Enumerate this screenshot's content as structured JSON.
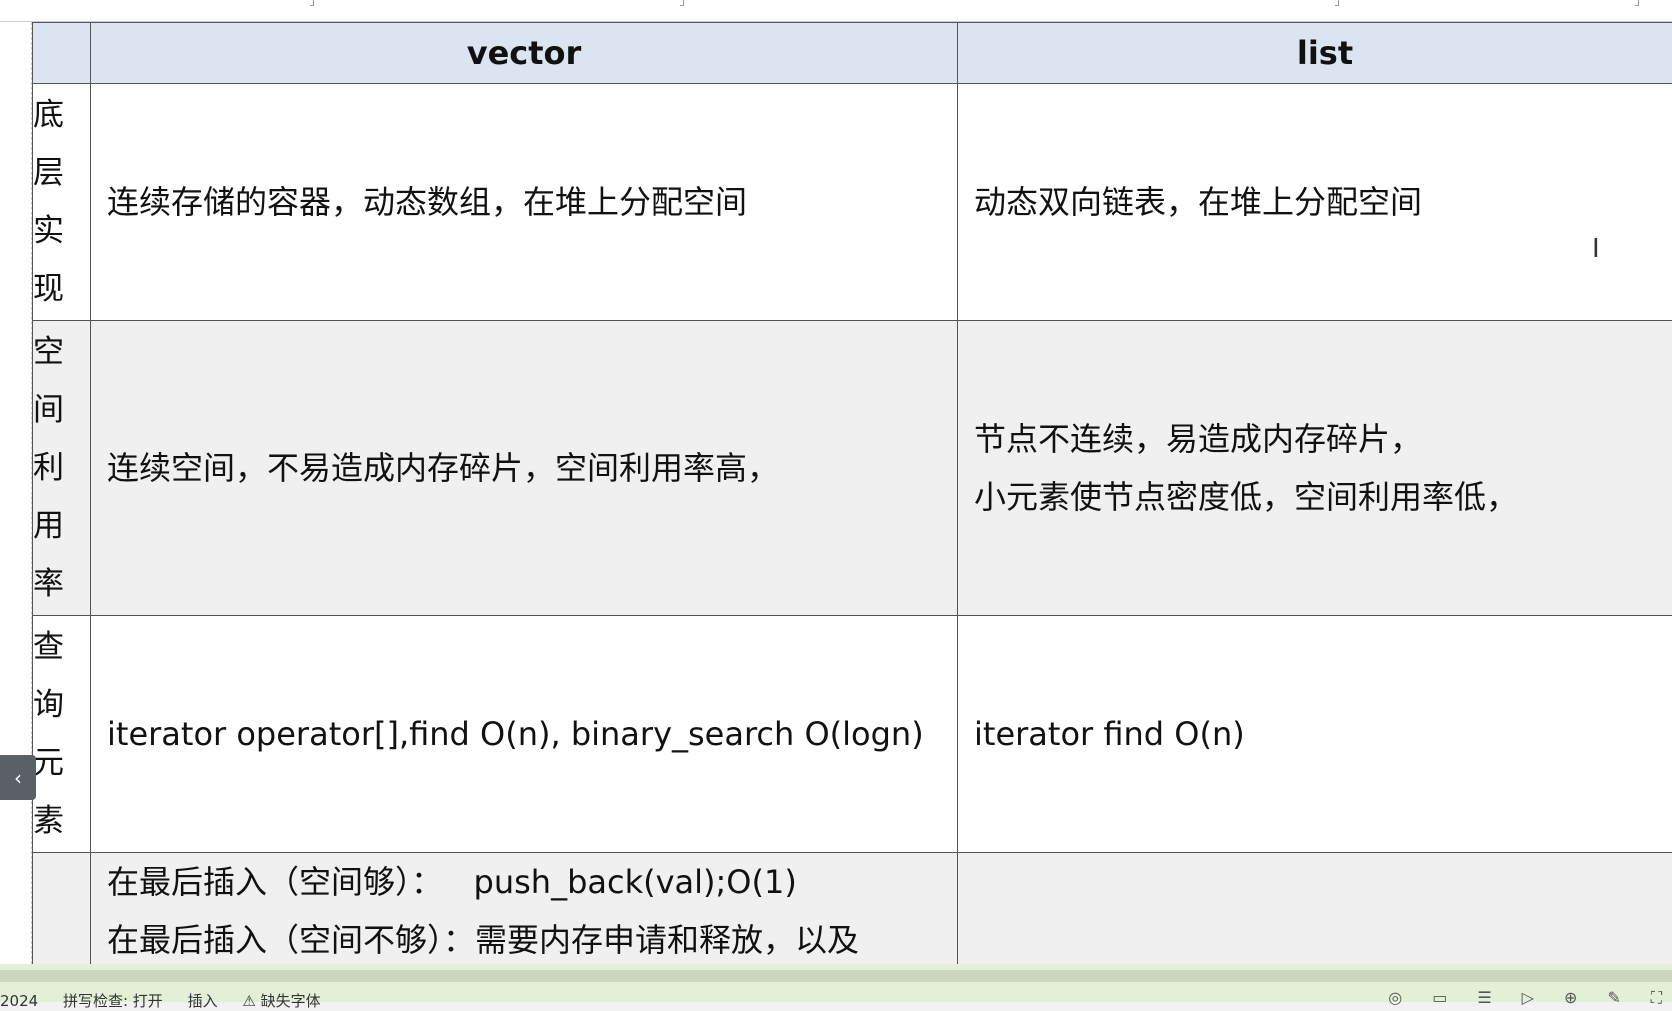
{
  "table": {
    "headers": [
      "",
      "vector",
      "list"
    ],
    "rows": [
      {
        "label": "底层实现",
        "vector": [
          "连续存储的容器，动态数组，在堆上分配空间"
        ],
        "list": [
          "动态双向链表，在堆上分配空间"
        ]
      },
      {
        "label": "空间利用率",
        "vector": [
          "连续空间，不易造成内存碎片，空间利用率高，"
        ],
        "list": [
          "节点不连续，易造成内存碎片，",
          "小元素使节点密度低，空间利用率低，"
        ]
      },
      {
        "label": "查询元素",
        "vector": [
          "iterator operator[],find O(n), binary_search O(logn)"
        ],
        "list": [
          "iterator find O(n)"
        ]
      },
      {
        "label": "",
        "vector": [
          "在最后插入（空间够）：   push_back(val);O(1)",
          "在最后插入（空间不够）：需要内存申请和释放，以及"
        ],
        "list": []
      }
    ]
  },
  "status": {
    "items": [
      "2024",
      "拼写检查: 打开",
      "插入",
      "⚠ 缺失字体"
    ]
  },
  "icons": [
    "collapse-left-icon",
    "text-cursor-icon"
  ]
}
